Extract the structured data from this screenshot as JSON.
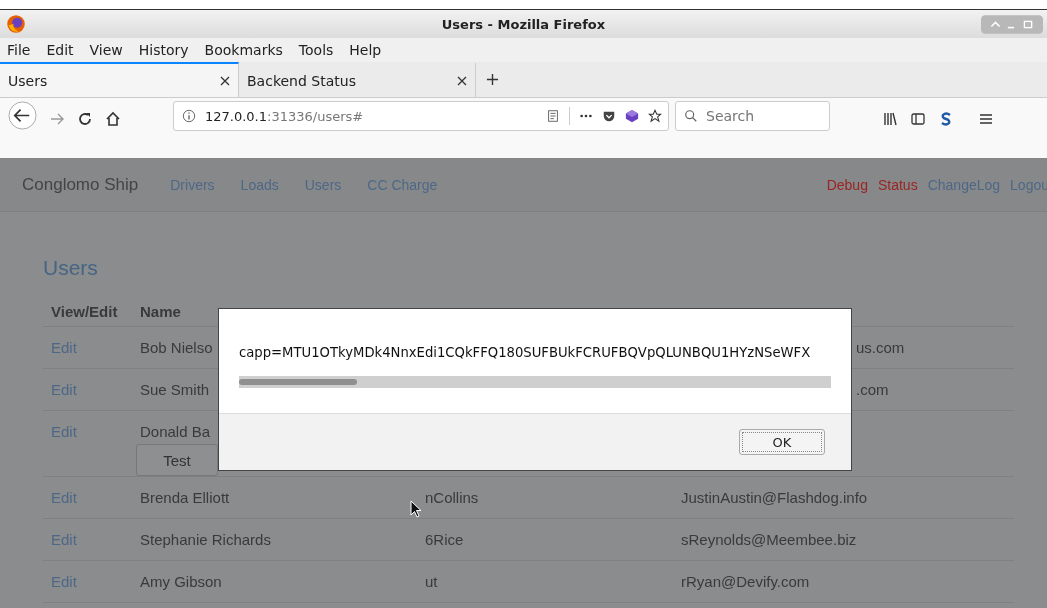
{
  "window": {
    "title": "Users - Mozilla Firefox"
  },
  "menu": [
    "File",
    "Edit",
    "View",
    "History",
    "Bookmarks",
    "Tools",
    "Help"
  ],
  "tabs": [
    {
      "label": "Users",
      "selected": true
    },
    {
      "label": "Backend Status",
      "selected": false
    }
  ],
  "url": {
    "host": "127.0.0.1",
    "rest": ":31336/users#"
  },
  "search": {
    "placeholder": "Search"
  },
  "navbar": {
    "brand": "Conglomo Ship",
    "left": [
      {
        "label": "Drivers",
        "kind": "normal"
      },
      {
        "label": "Loads",
        "kind": "normal"
      },
      {
        "label": "Users",
        "kind": "normal"
      },
      {
        "label": "CC Charge",
        "kind": "normal"
      }
    ],
    "right": [
      {
        "label": "Debug",
        "kind": "danger"
      },
      {
        "label": "Status",
        "kind": "danger"
      },
      {
        "label": "ChangeLog",
        "kind": "normal"
      },
      {
        "label": "Logou",
        "kind": "normal"
      }
    ]
  },
  "heading": "Users",
  "table": {
    "columns": [
      "View/Edit",
      "Name"
    ],
    "rows": [
      {
        "action": "Edit",
        "name": "Bob Nielso",
        "email_end": "us.com"
      },
      {
        "action": "Edit",
        "name": "Sue Smith",
        "email_end": ".com"
      },
      {
        "action": "Edit",
        "name": "Donald Ba",
        "button": "Test"
      },
      {
        "action": "Edit",
        "name": "Brenda Elliott",
        "username": "nCollins",
        "email": "JustinAustin@Flashdog.info"
      },
      {
        "action": "Edit",
        "name": "Stephanie Richards",
        "username": "6Rice",
        "email": "sReynolds@Meembee.biz"
      },
      {
        "action": "Edit",
        "name": "Amy Gibson",
        "username": "ut",
        "email": "rRyan@Devify.com"
      }
    ]
  },
  "dialog": {
    "message": "capp=MTU1OTkyMDk4NnxEdi1CQkFFQ180SUFBUkFCRUFBQVpQLUNBQU1HYzNSeWFX",
    "button": "OK"
  }
}
